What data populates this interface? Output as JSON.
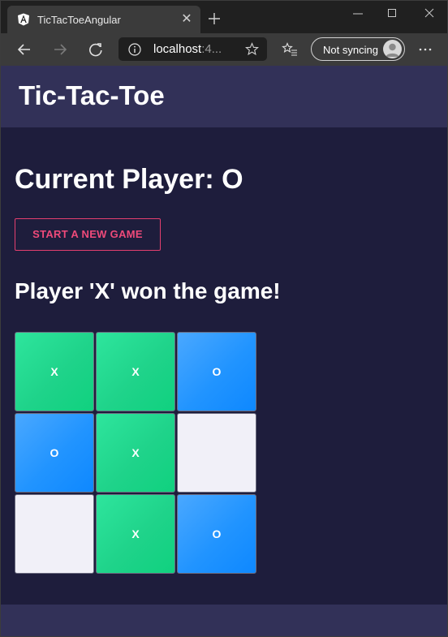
{
  "browser": {
    "tab_title": "TicTacToeAngular",
    "address_host": "localhost",
    "address_rest": ":4...",
    "sync_label": "Not syncing",
    "icons": {
      "favicon": "angular-icon",
      "tab_close": "close-icon",
      "new_tab": "plus-icon",
      "back": "back-arrow-icon",
      "forward": "forward-arrow-icon",
      "refresh": "refresh-icon",
      "site_info": "info-icon",
      "favorite": "star-icon",
      "favorites": "favorites-icon",
      "more": "more-icon"
    }
  },
  "app": {
    "title": "Tic-Tac-Toe",
    "current_player": "Current Player: O",
    "new_game_label": "START A NEW GAME",
    "status": "Player 'X' won the game!",
    "colors": {
      "header_bg": "#323158",
      "page_bg": "#1e1d3c",
      "button_accent": "#e43f6f",
      "x_cell": "#1fd38a",
      "o_cell": "#2194ff",
      "empty_cell": "#f1f0f8"
    },
    "board": [
      [
        "X",
        "X",
        "O"
      ],
      [
        "O",
        "X",
        ""
      ],
      [
        "",
        "X",
        "O"
      ]
    ]
  }
}
